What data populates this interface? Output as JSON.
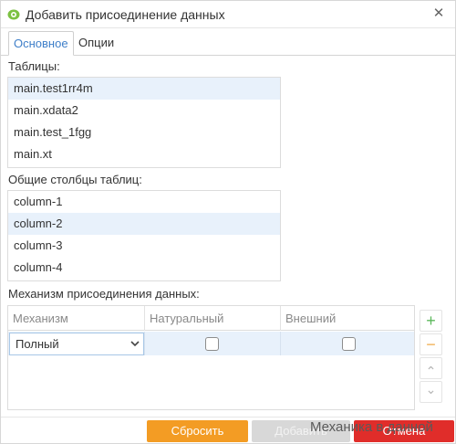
{
  "dialog": {
    "title": "Добавить присоединение данных",
    "close_glyph": "✕",
    "icon": "app-icon"
  },
  "tabs": [
    {
      "label": "Основное",
      "active": true
    },
    {
      "label": "Опции",
      "active": false
    }
  ],
  "tables": {
    "label": "Таблицы:",
    "items": [
      "main.test1rr4m",
      "main.xdata2",
      "main.test_1fgg",
      "main.xt"
    ],
    "selected_index": 0
  },
  "columns": {
    "label": "Общие столбцы таблиц:",
    "items": [
      "column-1",
      "column-2",
      "column-3",
      "column-4"
    ],
    "selected_index": 1
  },
  "join": {
    "label": "Механизм присоединения данных:",
    "headers": [
      "Механизм",
      "Натуральный",
      "Внешний"
    ],
    "rows": [
      {
        "mechanism": "Полный",
        "natural": false,
        "outer": false
      }
    ]
  },
  "side_buttons": {
    "add": "+",
    "remove": "−",
    "up": "⌃",
    "down": "⌄"
  },
  "footer": {
    "reset": "Сбросить",
    "add": "Добавить",
    "cancel": "Отмена",
    "overlay": "Механика в данной"
  },
  "colors": {
    "accent_blue": "#3f7fc9",
    "reset_orange": "#f39c24",
    "cancel_red": "#e02d2a",
    "add_green": "#5cb85c",
    "remove_orange": "#f0ad4e",
    "selection": "#e8f1fb"
  }
}
